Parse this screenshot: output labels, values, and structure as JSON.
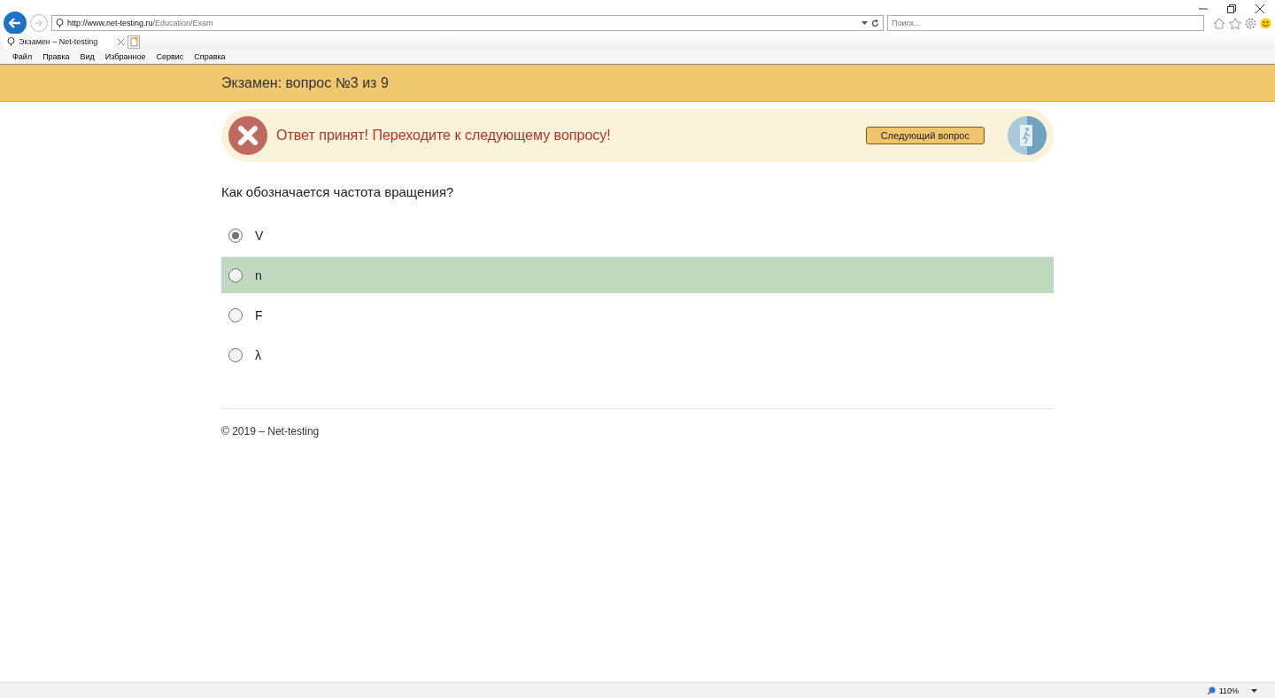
{
  "browser": {
    "url_host": "http://www.net-testing.ru",
    "url_path": "/Education/Exam",
    "search_placeholder": "Поиск...",
    "tab": {
      "title": "Экзамен – Net-testing",
      "selected": true
    },
    "menu": [
      "Файл",
      "Правка",
      "Вид",
      "Избранное",
      "Сервис",
      "Справка"
    ],
    "zoom": "110%"
  },
  "header": {
    "title": "Экзамен: вопрос №3 из 9"
  },
  "alert": {
    "message": "Ответ принят! Переходите к следующему вопросу!",
    "button": "Следующий вопрос"
  },
  "question": "Как обозначается частота вращения?",
  "options": [
    {
      "label": "V",
      "selected": true,
      "correct": false
    },
    {
      "label": "n",
      "selected": false,
      "correct": true
    },
    {
      "label": "F",
      "selected": false,
      "correct": false
    },
    {
      "label": "λ",
      "selected": false,
      "correct": false
    }
  ],
  "footer": "© 2019 – Net-testing"
}
